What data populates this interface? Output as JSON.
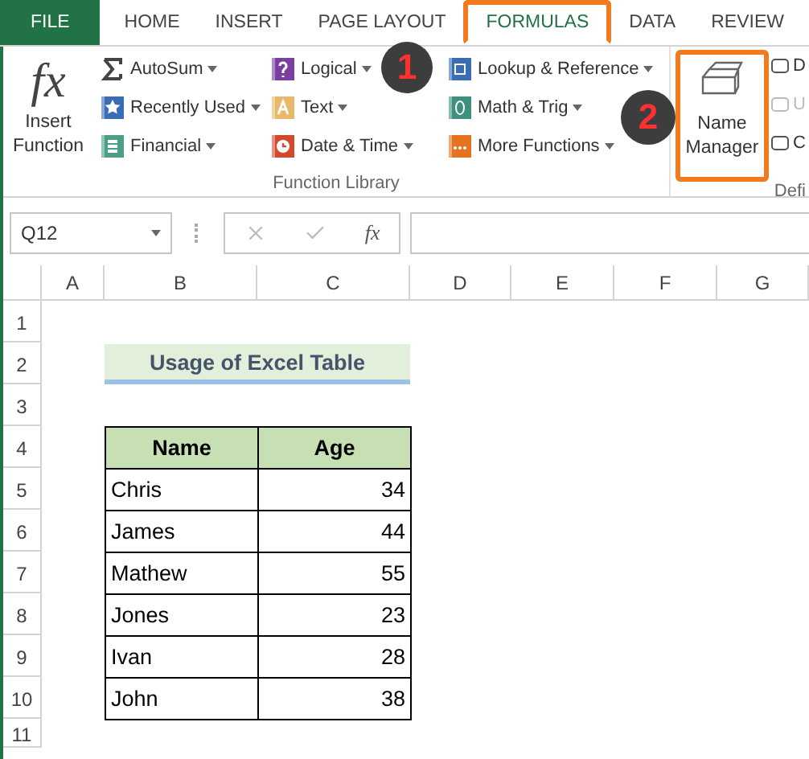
{
  "tabs": [
    {
      "label": "FILE",
      "kind": "file",
      "selected": false,
      "highlighted": false
    },
    {
      "label": "HOME",
      "kind": "tab",
      "selected": false,
      "highlighted": false
    },
    {
      "label": "INSERT",
      "kind": "tab",
      "selected": false,
      "highlighted": false
    },
    {
      "label": "PAGE LAYOUT",
      "kind": "tab",
      "selected": false,
      "highlighted": false
    },
    {
      "label": "FORMULAS",
      "kind": "tab",
      "selected": true,
      "highlighted": true
    },
    {
      "label": "DATA",
      "kind": "tab",
      "selected": false,
      "highlighted": false
    },
    {
      "label": "REVIEW",
      "kind": "tab",
      "selected": false,
      "highlighted": false
    }
  ],
  "ribbon": {
    "function_library": {
      "label": "Function Library",
      "insert_function": {
        "symbol": "fx",
        "label": "Insert Function"
      },
      "columns": [
        [
          {
            "label": "AutoSum",
            "kind": "sum"
          },
          {
            "label": "Recently Used",
            "kind": "star"
          },
          {
            "label": "Financial",
            "kind": "financial"
          }
        ],
        [
          {
            "label": "Logical",
            "kind": "logical"
          },
          {
            "label": "Text",
            "kind": "text"
          },
          {
            "label": "Date & Time",
            "kind": "datetime"
          }
        ],
        [
          {
            "label": "Lookup & Reference",
            "kind": "lookup"
          },
          {
            "label": "Math & Trig",
            "kind": "math"
          },
          {
            "label": "More Functions",
            "kind": "more"
          }
        ]
      ]
    },
    "defined_names": {
      "label": "Defi",
      "name_manager": {
        "label": "Name Manager",
        "highlighted": true
      },
      "items": [
        {
          "label": "D",
          "disabled": false
        },
        {
          "label": "U",
          "disabled": true
        },
        {
          "label": "C",
          "disabled": false
        }
      ]
    }
  },
  "callouts": [
    {
      "number": "1"
    },
    {
      "number": "2"
    }
  ],
  "formula_bar": {
    "name_box": "Q12",
    "symbol": "fx"
  },
  "sheet": {
    "columns": [
      "A",
      "B",
      "C",
      "D",
      "E",
      "F",
      "G"
    ],
    "rows": [
      "1",
      "2",
      "3",
      "4",
      "5",
      "6",
      "7",
      "8",
      "9",
      "10",
      "11"
    ],
    "title": "Usage of Excel Table",
    "table": {
      "columns": [
        "Name",
        "Age"
      ],
      "rows": [
        [
          "Chris",
          "34"
        ],
        [
          "James",
          "44"
        ],
        [
          "Mathew",
          "55"
        ],
        [
          "Jones",
          "23"
        ],
        [
          "Ivan",
          "28"
        ],
        [
          "John",
          "38"
        ]
      ]
    }
  }
}
